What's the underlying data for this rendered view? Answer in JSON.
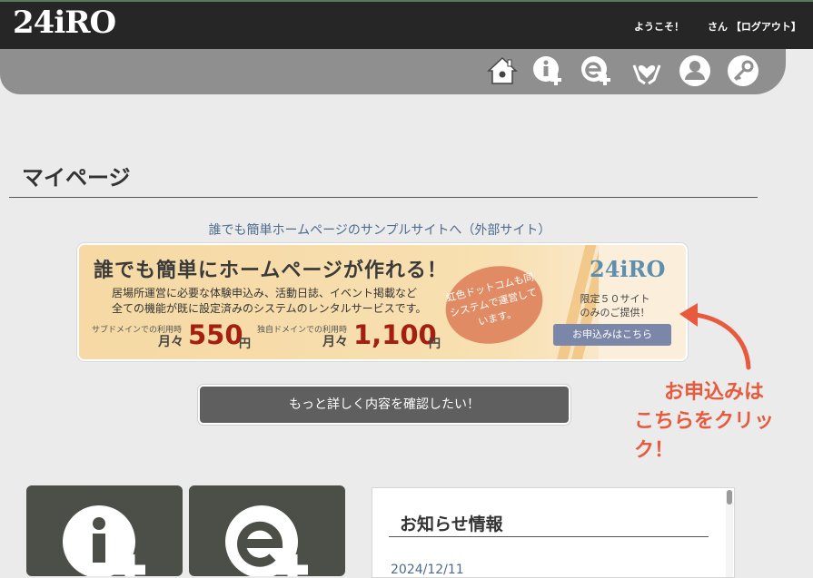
{
  "header": {
    "logo": "24iRO",
    "welcome": "ようこそ！",
    "user_label": "さん 【ログアウト】"
  },
  "nav_icons": [
    "home-icon",
    "info-add-icon",
    "event-add-icon",
    "hands-heart-icon",
    "user-icon",
    "key-icon"
  ],
  "page": {
    "title": "マイページ",
    "sample_link": "誰でも簡単ホームページのサンプルサイトへ（外部サイト）"
  },
  "banner": {
    "headline": "誰でも簡単にホームページが作れる！",
    "line1": "居場所運営に必要な体験申込み、活動日誌、イベント掲載など",
    "line2": "全ての機能が既に設定済みのシステムのレンタルサービスです。",
    "subdomain_label": "サブドメインでの利用時",
    "subdomain_prefix": "月々",
    "subdomain_price": "550",
    "subdomain_unit": "円",
    "domain_label": "独自ドメインでの利用時",
    "domain_prefix": "月々",
    "domain_price": "1,100",
    "domain_unit": "円",
    "circle_text": "虹色ドットコムも同システムで運営しています。",
    "logo": "24iRO",
    "limit_line1": "限定５０サイト",
    "limit_line2": "のみのご提供！",
    "apply_label": "お申込みはこちら"
  },
  "more_button": "もっと詳しく内容を確認したい！",
  "callout": {
    "line1": "お申込みは",
    "line2": "こちらをクリック！"
  },
  "news": {
    "title": "お知らせ情報",
    "first_date": "2024/12/11"
  },
  "colors": {
    "topbar": "#262626",
    "iconbar": "#8f8f8f",
    "accent_red": "#e85a3d",
    "price_red": "#a51f10",
    "link_blue": "#4d6b8f"
  }
}
